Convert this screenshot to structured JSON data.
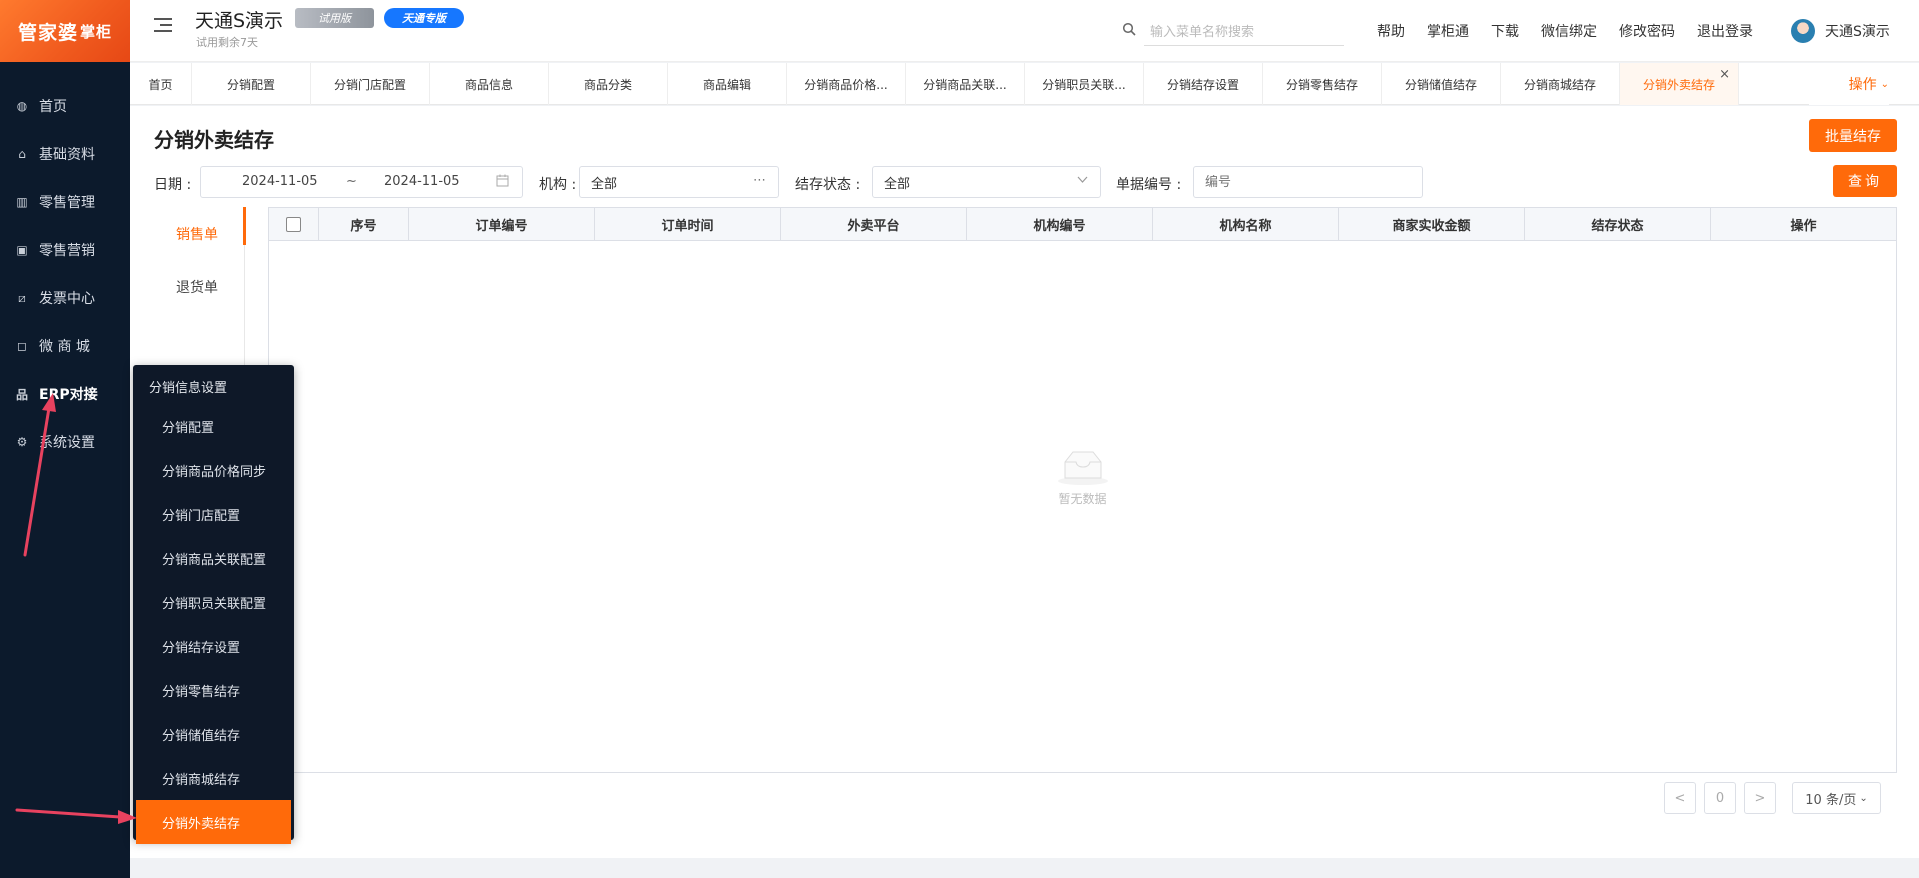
{
  "brand": {
    "logo_main": "管家婆",
    "logo_sub": "掌柜"
  },
  "sidebar": {
    "items": [
      {
        "label": "首页",
        "icon": "globe-icon"
      },
      {
        "label": "基础资料",
        "icon": "home-icon"
      },
      {
        "label": "零售管理",
        "icon": "bar-chart-icon"
      },
      {
        "label": "零售营销",
        "icon": "gift-icon"
      },
      {
        "label": "发票中心",
        "icon": "trend-icon"
      },
      {
        "label": "微 商 城",
        "icon": "bag-icon"
      },
      {
        "label": "ERP对接",
        "icon": "org-icon"
      },
      {
        "label": "系统设置",
        "icon": "gear-icon"
      }
    ]
  },
  "header": {
    "company": "天通S演示",
    "trial_text": "试用剩余7天",
    "badge_trial": "试用版",
    "badge_pro": "天通专版",
    "search_placeholder": "输入菜单名称搜索",
    "links": [
      "帮助",
      "掌柜通",
      "下载",
      "微信绑定",
      "修改密码",
      "退出登录"
    ],
    "user_name": "天通S演示"
  },
  "tabs": {
    "items": [
      {
        "label": "首页"
      },
      {
        "label": "分销配置"
      },
      {
        "label": "分销门店配置"
      },
      {
        "label": "商品信息"
      },
      {
        "label": "商品分类"
      },
      {
        "label": "商品编辑"
      },
      {
        "label": "分销商品价格..."
      },
      {
        "label": "分销商品关联..."
      },
      {
        "label": "分销职员关联..."
      },
      {
        "label": "分销结存设置"
      },
      {
        "label": "分销零售结存"
      },
      {
        "label": "分销储值结存"
      },
      {
        "label": "分销商城结存"
      },
      {
        "label": "分销外卖结存"
      }
    ],
    "close_glyph": "×",
    "ops_label": "操作"
  },
  "page": {
    "title": "分销外卖结存",
    "batch_button": "批量结存",
    "query_button": "查询"
  },
  "filters": {
    "date_label": "日期 :",
    "date_start": "2024-11-05",
    "date_sep": "~",
    "date_end": "2024-11-05",
    "org_label": "机构 :",
    "org_value": "全部",
    "status_label": "结存状态 :",
    "status_value": "全部",
    "doc_label": "单据编号 :",
    "doc_placeholder": "编号"
  },
  "subtabs": [
    {
      "label": "销售单"
    },
    {
      "label": "退货单"
    }
  ],
  "table": {
    "columns": [
      "序号",
      "订单编号",
      "订单时间",
      "外卖平台",
      "机构编号",
      "机构名称",
      "商家实收金额",
      "结存状态",
      "操作"
    ],
    "empty_text": "暂无数据"
  },
  "pagination": {
    "prev": "<",
    "page": "0",
    "next": ">",
    "page_size": "10 条/页"
  },
  "flyout": {
    "title": "分销信息设置",
    "items": [
      {
        "label": "分销配置"
      },
      {
        "label": "分销商品价格同步"
      },
      {
        "label": "分销门店配置"
      },
      {
        "label": "分销商品关联配置"
      },
      {
        "label": "分销职员关联配置"
      },
      {
        "label": "分销结存设置"
      },
      {
        "label": "分销零售结存"
      },
      {
        "label": "分销储值结存"
      },
      {
        "label": "分销商城结存"
      },
      {
        "label": "分销外卖结存"
      }
    ]
  },
  "colors": {
    "accent": "#ff6a0a",
    "sidebar_bg": "#0c1a2c",
    "annotation": "#e8425f"
  }
}
